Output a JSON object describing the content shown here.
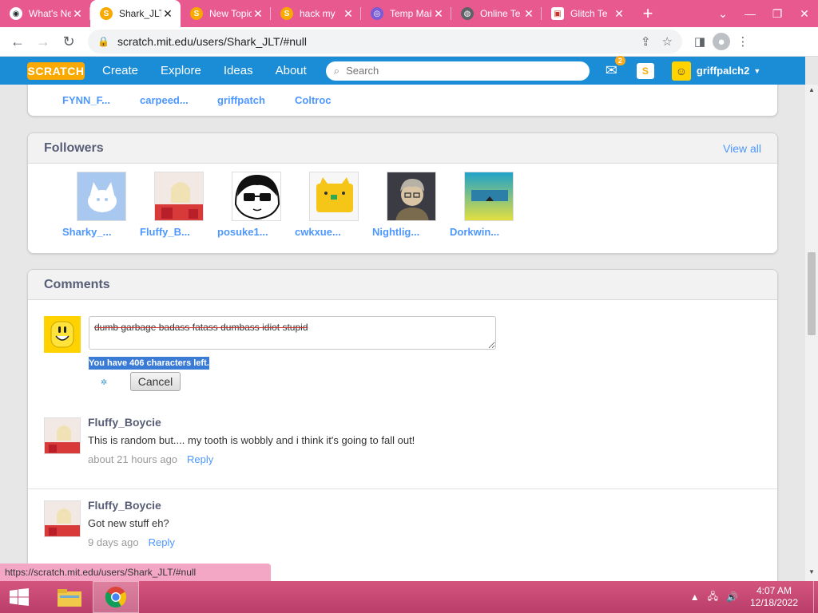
{
  "browser": {
    "tabs": [
      {
        "title": "What's New",
        "favicon_color": "#24292e",
        "favicon_glyph": "◉"
      },
      {
        "title": "Shark_JLT",
        "favicon_color": "#f9a900",
        "favicon_glyph": "S",
        "active": true
      },
      {
        "title": "New Topic",
        "favicon_color": "#f9a900",
        "favicon_glyph": "S"
      },
      {
        "title": "hack my",
        "favicon_color": "#f9a900",
        "favicon_glyph": "S"
      },
      {
        "title": "Temp Mail",
        "favicon_color": "#7b5cd6",
        "favicon_glyph": "◎"
      },
      {
        "title": "Online Te",
        "favicon_color": "#5f6368",
        "favicon_glyph": "◍"
      },
      {
        "title": "Glitch Te",
        "favicon_color": "#c0392b",
        "favicon_glyph": "▣"
      }
    ],
    "new_tab_label": "+",
    "url": "scratch.mit.edu/users/Shark_JLT/#null",
    "status_url": "https://scratch.mit.edu/users/Shark_JLT/#null"
  },
  "scratch_nav": {
    "logo": "SCRATCH",
    "links": [
      "Create",
      "Explore",
      "Ideas",
      "About"
    ],
    "search_placeholder": "Search",
    "message_count": "2",
    "username": "griffpalch2"
  },
  "following_partial": {
    "names": [
      "FYNN_F...",
      "carpeed...",
      "griffpatch",
      "Coltroc"
    ]
  },
  "followers": {
    "title": "Followers",
    "view_all": "View all",
    "users": [
      {
        "name": "Sharky_...",
        "thumb_color": "#a9c8f0"
      },
      {
        "name": "Fluffy_B...",
        "thumb_color": "#d83a3a"
      },
      {
        "name": "posuke1...",
        "thumb_color": "#ffffff"
      },
      {
        "name": "cwkxue...",
        "thumb_color": "#f5c518"
      },
      {
        "name": "Nightlig...",
        "thumb_color": "#6b5f55"
      },
      {
        "name": "Dorkwin...",
        "thumb_color": "#1fa2c9"
      }
    ]
  },
  "comments": {
    "title": "Comments",
    "draft_text": "dumb garbage badass fatass dumbass idiot stupid",
    "chars_left": "You have 406 characters left.",
    "cancel_label": "Cancel",
    "items": [
      {
        "author": "Fluffy_Boycie",
        "text": "This is random but.... my tooth is wobbly and i think it's going to fall out!",
        "time": "about 21 hours ago",
        "reply": "Reply"
      },
      {
        "author": "Fluffy_Boycie",
        "text": "Got new stuff eh?",
        "time": "9 days ago",
        "reply": "Reply"
      }
    ]
  },
  "taskbar": {
    "time": "4:07 AM",
    "date": "12/18/2022"
  }
}
